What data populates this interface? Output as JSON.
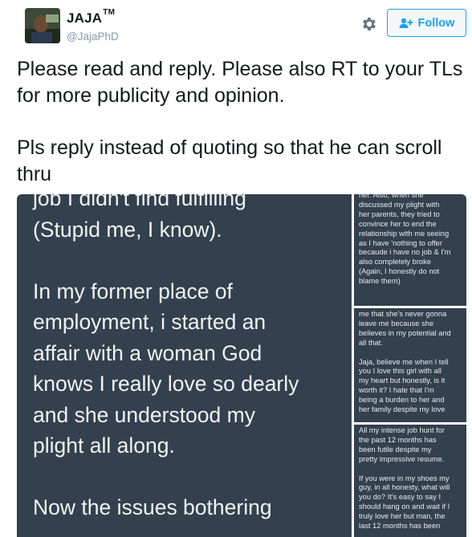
{
  "user": {
    "name": "JAJA",
    "badge": "TM",
    "handle": "@JajaPhD"
  },
  "actions": {
    "follow_label": "Follow",
    "settings_icon": "gear-icon",
    "follow_icon": "add-user-icon"
  },
  "colors": {
    "accent": "#1da1f2",
    "text": "#14171a",
    "muted": "#8899a6",
    "screenshot_bg": "#33404d"
  },
  "tweet": {
    "paragraph_1": "Please read and reply. Please also RT to your TLs for more publicity and opinion.",
    "paragraph_2": "Pls reply instead of quoting so that he can scroll thru"
  },
  "media": {
    "main_text": "job I didn't find fulfilling\n(Stupid me, I know).\n\nIn my former place of\nemployment, i started an\naffair with a woman God\nknows I really love so dearly\nand she understood my\nplight all along.\n\nNow the issues bothering",
    "side_1_text": "her. Also, when she\ndiscussed my plight with\nher parents, they tried to\nconvince her to end the\nrelationship with me seeing\nas I have 'nothing to offer\nbecaude i have no job & I'm\nalso completely broke\n(Again, I honestly do not\nblame them)",
    "side_2_text": "me that she's never gonna\nleave me because she\nbelieves in my potential and\nall that.\n\nJaja, believe me when I tell\nyou I love this girl with all\nmy heart but honestly, is it\nworth it? I hate that I'm\nbeing a burden to her and\nher family despite my love",
    "side_3_text": "All my intense job hunt for\nthe past 12 months has\nbeen futile despite my\npretty impressive resume.\n\nIf you were in my shoes my\nguy, in all honesty, what will\nyou do? It's easy to say I\nshould hang on and wait if I\ntruly love her but man, the\nlast 12 months has been"
  }
}
